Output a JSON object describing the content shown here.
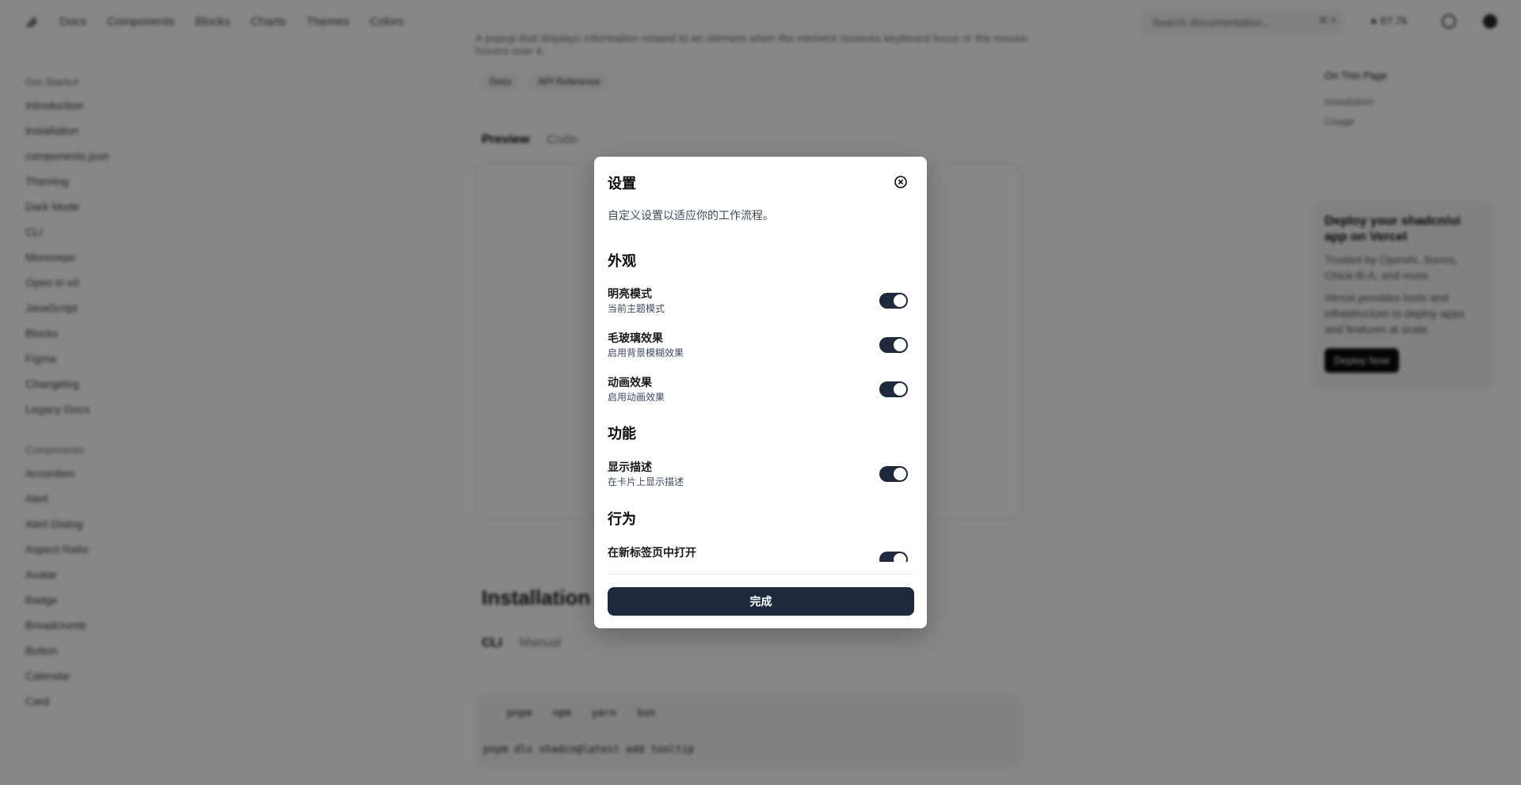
{
  "header": {
    "nav": [
      "Docs",
      "Components",
      "Blocks",
      "Charts",
      "Themes",
      "Colors"
    ],
    "search_placeholder": "Search documentation...",
    "search_kbd": "⌘ K",
    "github_stars": "87.7k"
  },
  "sidebar": {
    "getting_started_heading": "Get Started",
    "getting_started": [
      "Introduction",
      "Installation",
      "components.json",
      "Theming",
      "Dark Mode",
      "CLI",
      "Monorepo",
      "Open in v0",
      "JavaScript",
      "Blocks",
      "Figma",
      "Changelog",
      "Legacy Docs"
    ],
    "components_heading": "Components",
    "components": [
      "Accordion",
      "Alert",
      "Alert Dialog",
      "Aspect Ratio",
      "Avatar",
      "Badge",
      "Breadcrumb",
      "Button",
      "Calendar",
      "Card"
    ]
  },
  "main": {
    "intro_line": "A popup that displays information related to an element when the element receives keyboard focus or the mouse hovers over it.",
    "chips": [
      "Docs",
      "API Reference"
    ],
    "tabs": [
      "Preview",
      "Code"
    ],
    "installation_title": "Installation",
    "install_tabs": [
      "CLI",
      "Manual"
    ],
    "code_tabs": [
      "pnpm",
      "npm",
      "yarn",
      "bun"
    ],
    "code_line": "pnpm dlx shadcn@latest add tooltip"
  },
  "toc": {
    "heading": "On This Page",
    "items": [
      "Installation",
      "Usage"
    ]
  },
  "promo": {
    "title": "Deploy your shadcn/ui app on Vercel",
    "text1": "Trusted by OpenAI, Sonos, Chick-fil-A, and more.",
    "text2": "Vercel provides tools and infrastructure to deploy apps and features at scale.",
    "button": "Deploy Now"
  },
  "modal": {
    "title": "设置",
    "description": "自定义设置以适应你的工作流程。",
    "sections": [
      {
        "title": "外观",
        "items": [
          {
            "label": "明亮模式",
            "sub": "当前主题模式",
            "on": true
          },
          {
            "label": "毛玻璃效果",
            "sub": "启用背景模糊效果",
            "on": true
          },
          {
            "label": "动画效果",
            "sub": "启用动画效果",
            "on": true
          }
        ]
      },
      {
        "title": "功能",
        "items": [
          {
            "label": "显示描述",
            "sub": "在卡片上显示描述",
            "on": true
          }
        ]
      },
      {
        "title": "行为",
        "items": [
          {
            "label": "在新标签页中打开",
            "sub": "",
            "on": true
          }
        ]
      }
    ],
    "done_label": "完成",
    "colors": {
      "toggle_on": "#1e293b",
      "button_bg": "#1e293b",
      "description": "#3b4a5c"
    }
  }
}
